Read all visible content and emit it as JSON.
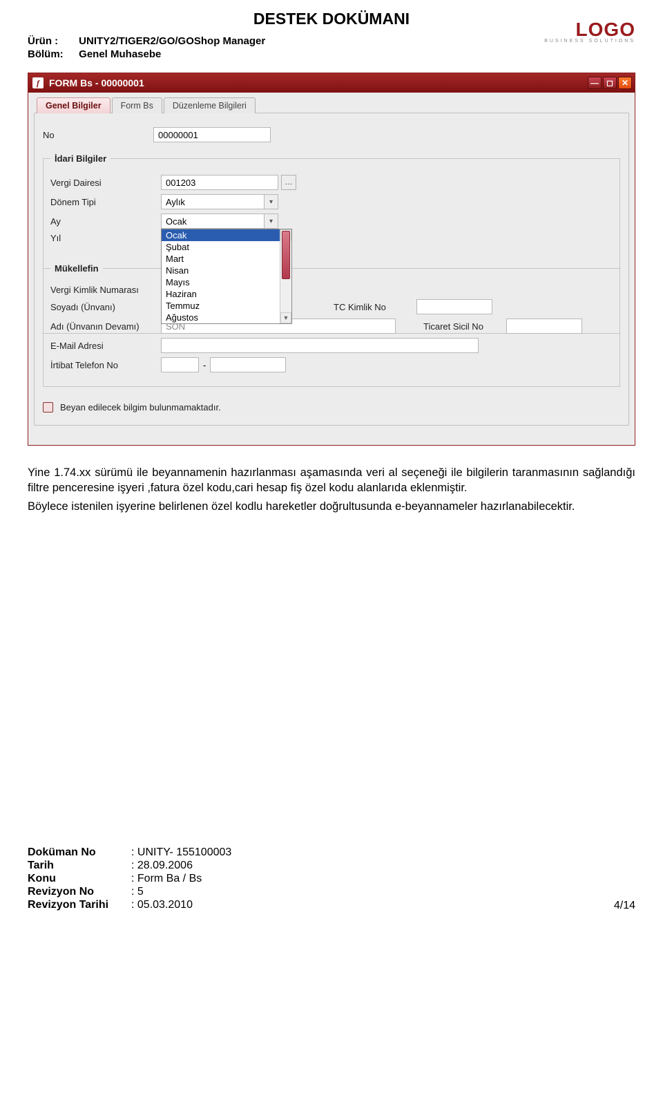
{
  "doc": {
    "title": "DESTEK DOKÜMANI",
    "urun_label": "Ürün  :",
    "urun_value": "UNITY2/TIGER2/GO/GOShop Manager",
    "bolum_label": "Bölüm:",
    "bolum_value": "Genel Muhasebe"
  },
  "logo": {
    "main": "LOGO",
    "sub": "BUSINESS  SOLUTIONS"
  },
  "window": {
    "title": "FORM Bs - 00000001",
    "icon_text": "f",
    "tabs": {
      "t0": "Genel Bilgiler",
      "t1": "Form Bs",
      "t2": "Düzenleme Bilgileri"
    },
    "no_label": "No",
    "no_value": "00000001",
    "idari_legend": "İdari Bilgiler",
    "vergi_dairesi_label": "Vergi Dairesi",
    "vergi_dairesi_value": "001203",
    "donem_tipi_label": "Dönem Tipi",
    "donem_tipi_value": "Aylık",
    "ay_label": "Ay",
    "ay_value": "Ocak",
    "yil_label": "Yıl",
    "months": {
      "m0": "Ocak",
      "m1": "Şubat",
      "m2": "Mart",
      "m3": "Nisan",
      "m4": "Mayıs",
      "m5": "Haziran",
      "m6": "Temmuz",
      "m7": "Ağustos"
    },
    "mukellef_legend": "Mükellefin",
    "vergi_kimlik_label": "Vergi Kimlik Numarası",
    "soyadi_label": "Soyadı (Ünvanı)",
    "adi_label": "Adı (Ünvanın Devamı)",
    "adi_placeholder": "SON",
    "email_label": "E-Mail Adresi",
    "irtibat_label": "İrtibat Telefon No",
    "tc_label": "TC Kimlik No",
    "ticaret_label": "Ticaret Sicil No",
    "declare_text": "Beyan edilecek bilgim bulunmamaktadır."
  },
  "paragraphs": {
    "p1": "Yine 1.74.xx sürümü ile beyannamenin hazırlanması aşamasında veri al seçeneği ile bilgilerin taranmasının sağlandığı filtre penceresine işyeri ,fatura özel kodu,cari hesap fiş özel kodu alanlarıda eklenmiştir.",
    "p2": "Böylece istenilen işyerine belirlenen özel kodlu hareketler doğrultusunda e-beyannameler hazırlanabilecektir."
  },
  "footer": {
    "dokuman_no_label": "Doküman No",
    "dokuman_no_value": ": UNITY- 155100003",
    "tarih_label": "Tarih",
    "tarih_value": ": 28.09.2006",
    "konu_label": "Konu",
    "konu_value": ": Form Ba / Bs",
    "revno_label": "Revizyon No",
    "revno_value": ": 5",
    "revtar_label": "Revizyon Tarihi",
    "revtar_value": ": 05.03.2010",
    "page": "4/14"
  }
}
